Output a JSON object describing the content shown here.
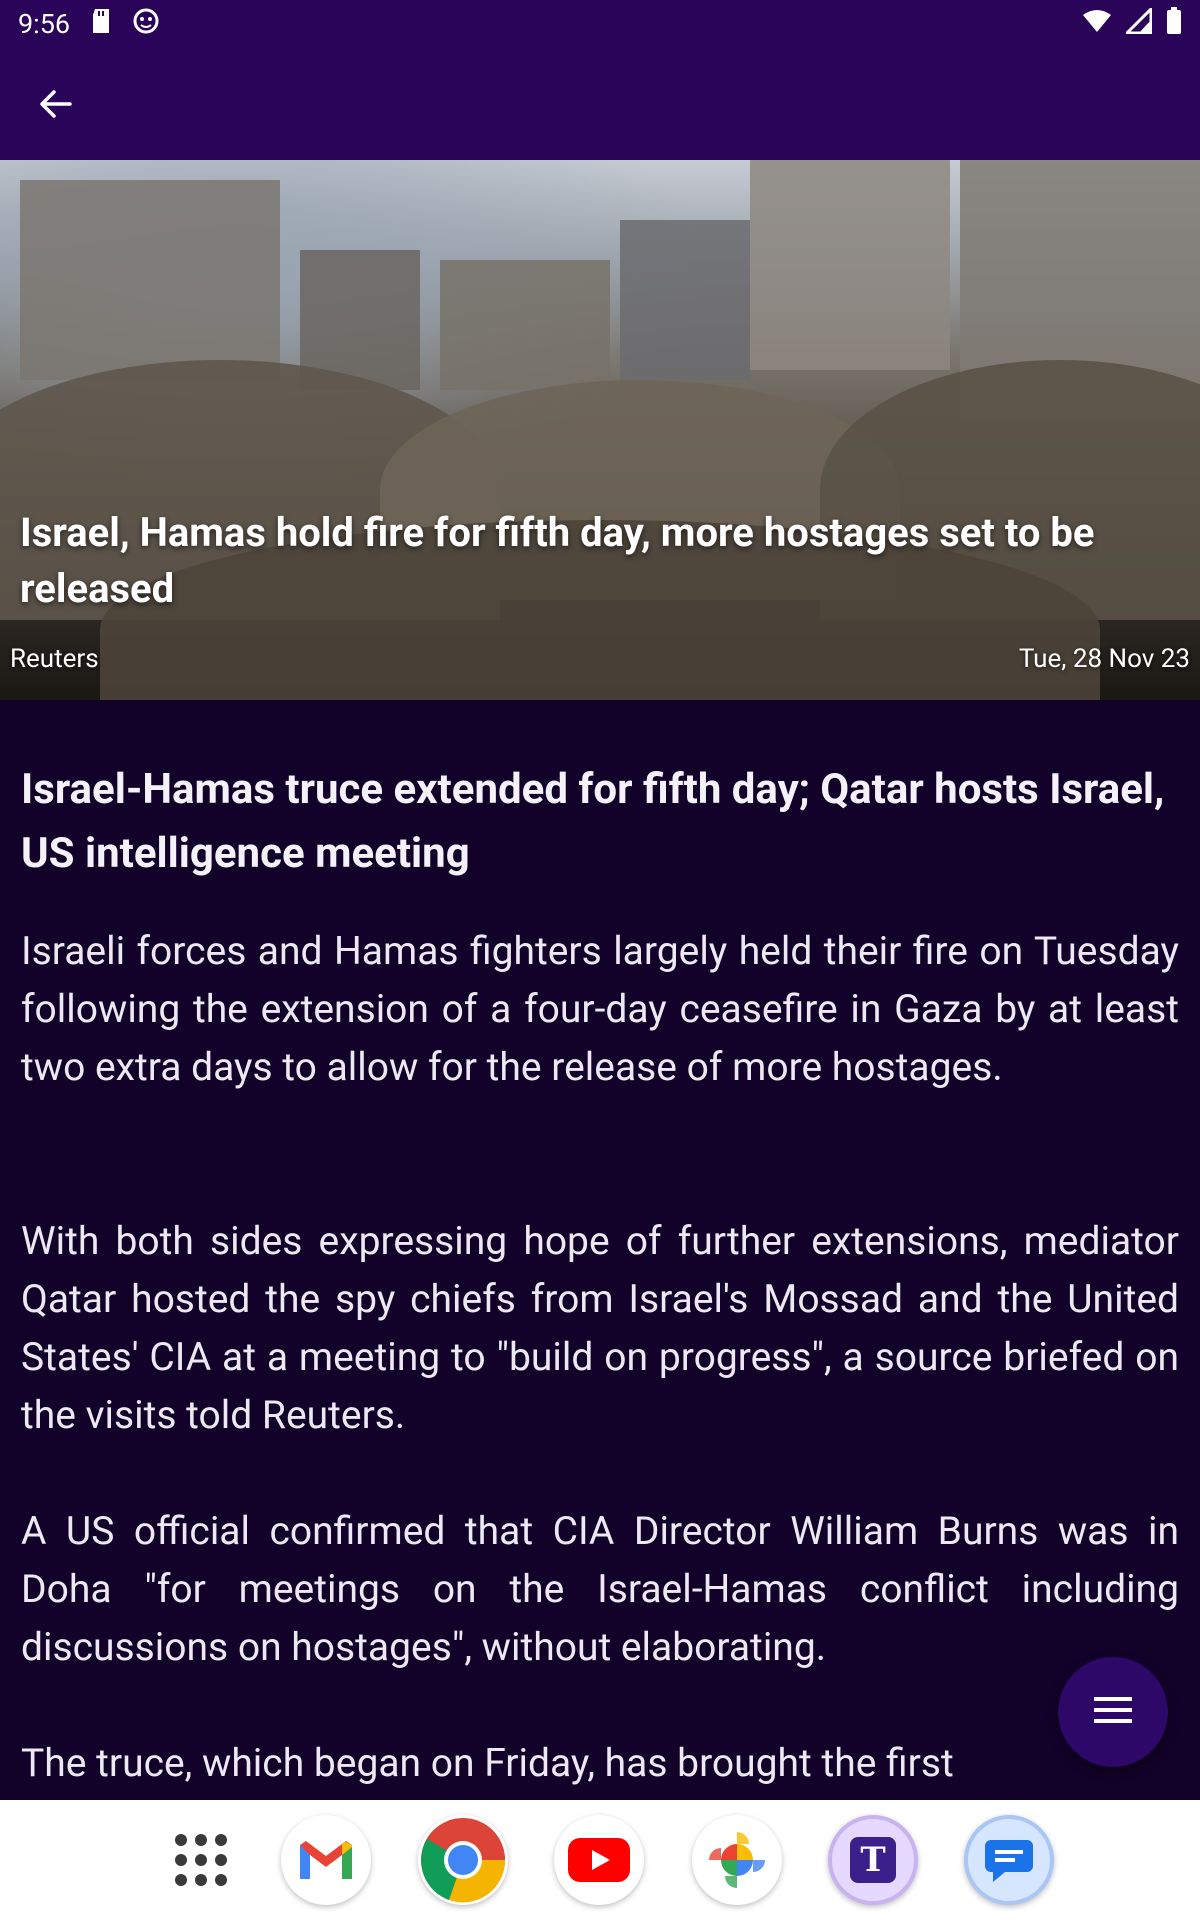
{
  "status_bar": {
    "time": "9:56"
  },
  "hero": {
    "title": "Israel, Hamas hold fire for fifth day, more hostages set to be released",
    "source": "Reuters",
    "date": "Tue, 28 Nov 23"
  },
  "article": {
    "headline": "Israel-Hamas truce extended for fifth day; Qatar hosts Israel, US intelligence meeting",
    "paragraphs": [
      "Israeli forces and Hamas fighters largely held their fire on Tuesday following the extension of a four-day ceasefire in Gaza by at least two extra days to allow for the release of more hostages.",
      "With both sides expressing hope of further extensions, mediator Qatar hosted the spy chiefs from Israel's Mossad and the United States' CIA at a meeting to \"build on progress\", a source briefed on the visits told Reuters.",
      "A US official confirmed that CIA Director William Burns was in Doha \"for meetings on the Israel-Hamas conflict including discussions on hostages\", without elaborating.",
      "The truce, which began on Friday, has brought the first"
    ]
  },
  "dock": {
    "apps": [
      "App drawer",
      "Gmail",
      "Chrome",
      "YouTube",
      "Photos",
      "T",
      "Messages"
    ],
    "t_letter": "T"
  },
  "colors": {
    "app_bar": "#2a0459",
    "background": "#12022a",
    "fab": "#2e0869"
  },
  "icons": [
    "back-arrow-icon",
    "sd-card-icon",
    "face-icon",
    "wifi-icon",
    "signal-icon",
    "battery-icon",
    "menu-icon"
  ]
}
